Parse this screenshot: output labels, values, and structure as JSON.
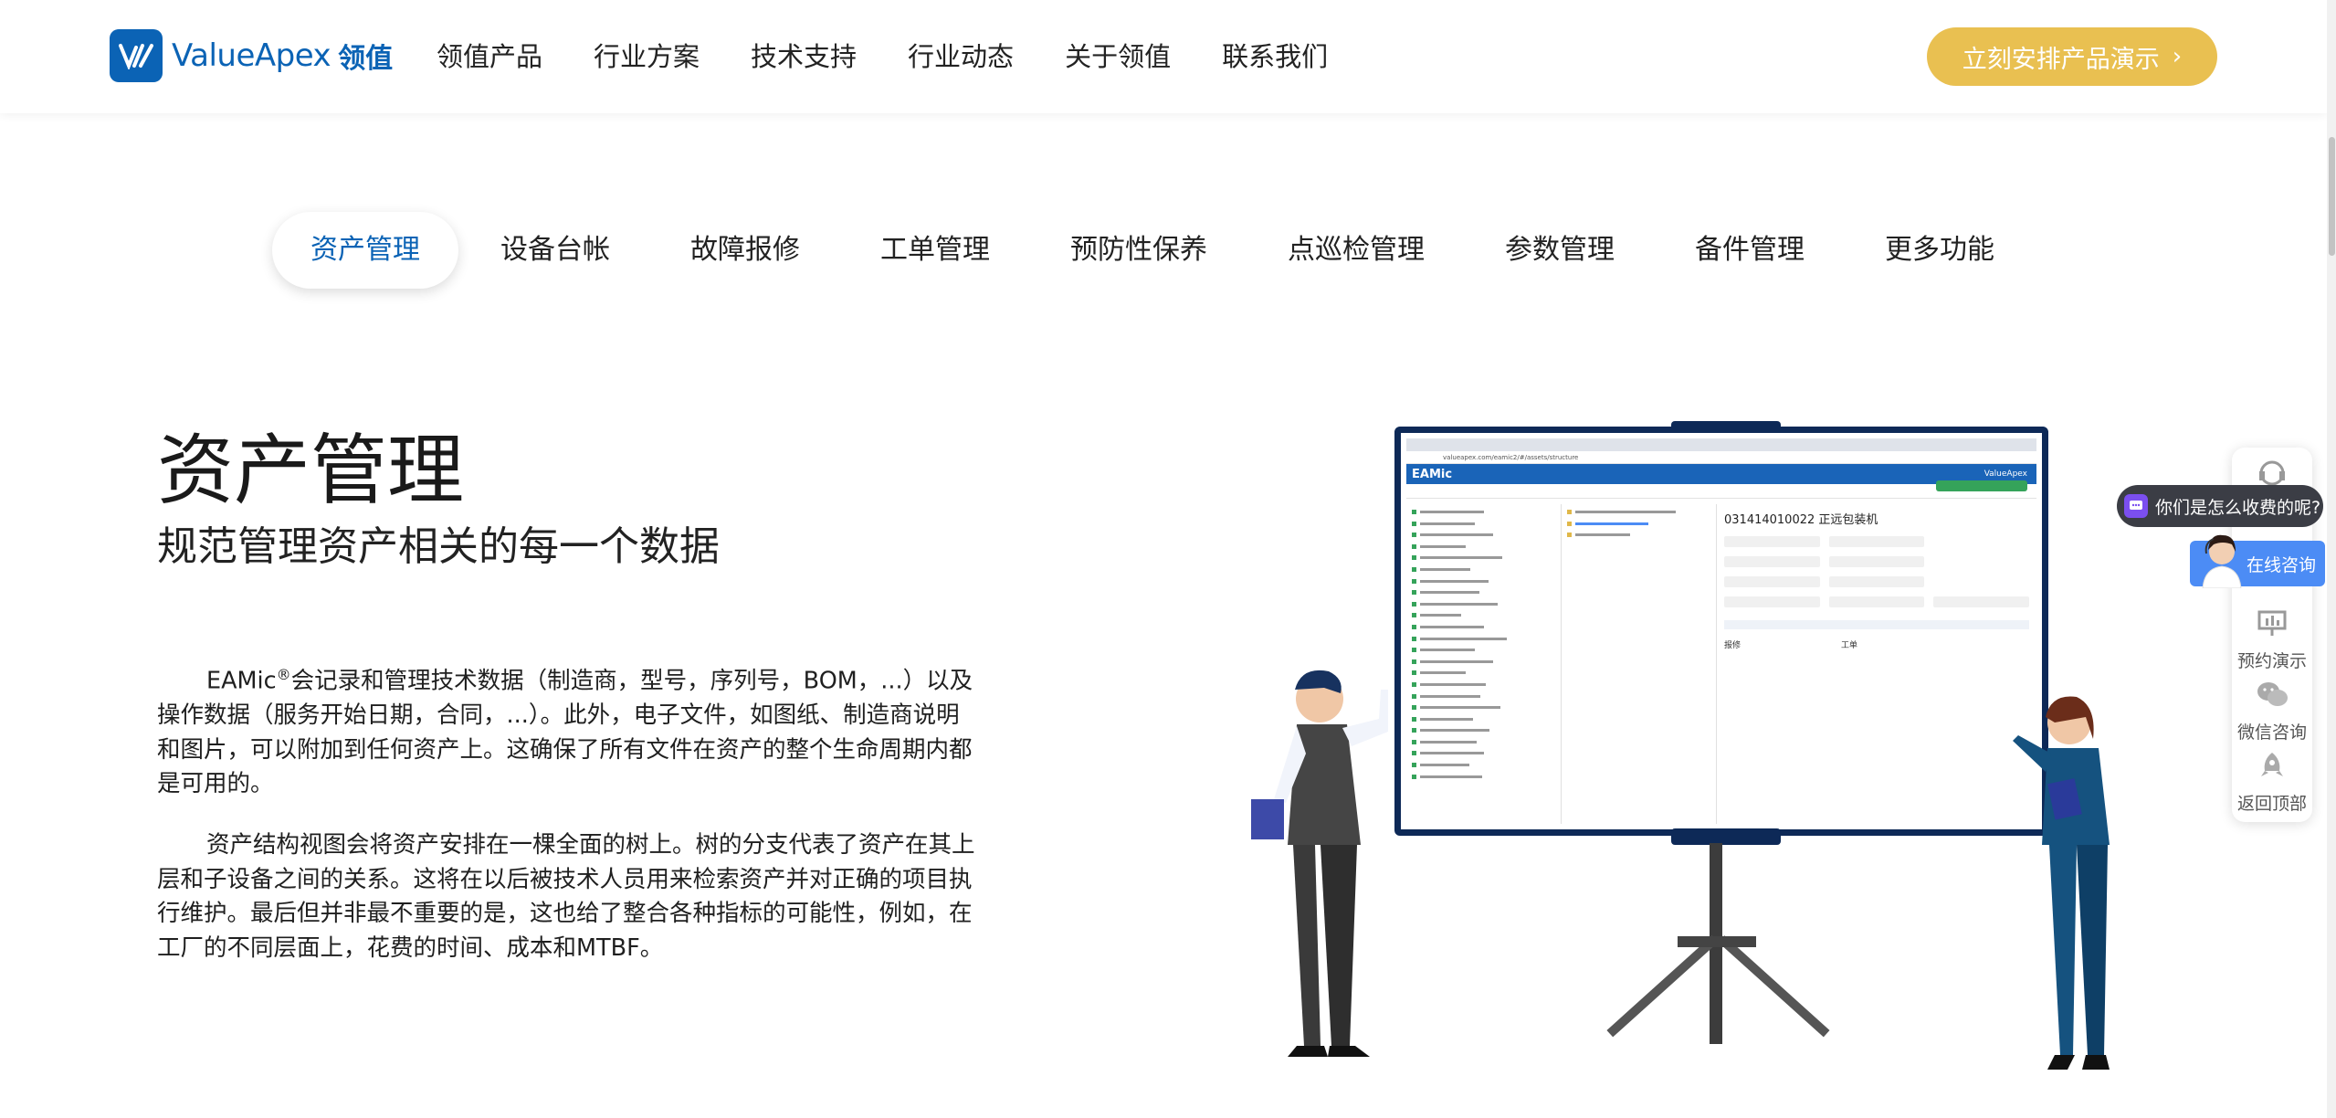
{
  "header": {
    "logo_text": "ValueApex",
    "logo_cn": "领值",
    "nav": [
      "领值产品",
      "行业方案",
      "技术支持",
      "行业动态",
      "关于领值",
      "联系我们"
    ],
    "cta_label": "立刻安排产品演示"
  },
  "tabs": [
    "资产管理",
    "设备台帐",
    "故障报修",
    "工单管理",
    "预防性保养",
    "点巡检管理",
    "参数管理",
    "备件管理",
    "更多功能"
  ],
  "active_tab": 0,
  "content": {
    "title": "资产管理",
    "subtitle": "规范管理资产相关的每一个数据",
    "p1_brand": "EAMic",
    "p1_mark": "®",
    "p1_text": "会记录和管理技术数据（制造商，型号，序列号，BOM，...）以及操作数据（服务开始日期，合同，...）。此外，电子文件，如图纸、制造商说明和图片，可以附加到任何资产上。这确保了所有文件在资产的整个生命周期内都是可用的。",
    "p2_text": "资产结构视图会将资产安排在一棵全面的树上。树的分支代表了资产在其上层和子设备之间的关系。这将在以后被技术人员用来检索资产并对正确的项目执行维护。最后但并非最不重要的是，这也给了整合各种指标的可能性，例如，在工厂的不同层面上，花费的时间、成本和MTBF。"
  },
  "screenshot_app": {
    "logo": "EAMic",
    "url": "valueapex.com/eamic2/#/assets/structure",
    "asset_code": "031414010022 正远包装机",
    "brand": "ValueApex",
    "section_repair": "报修",
    "section_order": "工单"
  },
  "side_widget": {
    "bubble_text": "你们是怎么收费的呢?",
    "consult_label": "在线咨询",
    "demo_label": "预约演示",
    "wechat_label": "微信咨询",
    "top_label": "返回顶部"
  },
  "colors": {
    "brand_blue": "#0b63b5",
    "cta_gold": "#e9c051",
    "board_navy": "#0d2957"
  }
}
